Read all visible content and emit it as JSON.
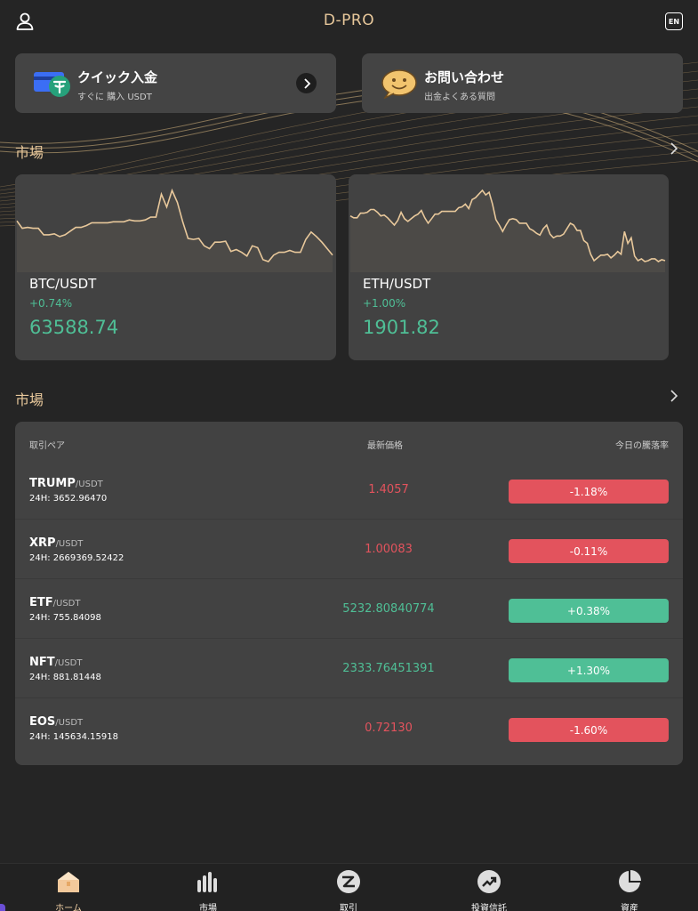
{
  "header": {
    "title": "D-PRO",
    "lang": "EN"
  },
  "quick": [
    {
      "title": "クイック入金",
      "subtitle": "すぐに 購入 USDT"
    },
    {
      "title": "お問い合わせ",
      "subtitle": "出金よくある質問"
    }
  ],
  "sections": {
    "market1": "市場",
    "market2": "市場"
  },
  "cards": [
    {
      "pair": "BTC/USDT",
      "change": "+0.74%",
      "price": "63588.74",
      "spark": [
        255,
        263,
        262,
        263,
        263,
        270,
        270,
        269,
        272,
        270,
        266,
        262,
        262,
        260,
        257,
        257,
        257,
        257,
        256,
        256,
        256,
        254,
        255,
        255,
        254,
        251,
        251,
        226,
        240,
        222,
        235,
        256,
        274,
        275,
        274,
        282,
        285,
        278,
        278,
        277,
        288,
        286,
        289,
        293,
        282,
        284,
        297,
        299,
        292,
        289,
        289,
        287,
        289,
        289,
        275,
        267,
        272,
        278,
        285,
        292
      ]
    },
    {
      "pair": "ETH/USDT",
      "change": "+1.00%",
      "price": "1901.82",
      "spark": [
        248,
        250,
        250,
        245,
        245,
        244,
        241,
        241,
        244,
        248,
        247,
        250,
        254,
        258,
        253,
        244,
        251,
        254,
        251,
        248,
        246,
        242,
        250,
        256,
        251,
        246,
        246,
        243,
        243,
        243,
        243,
        243,
        239,
        238,
        235,
        240,
        230,
        228,
        224,
        220,
        225,
        222,
        235,
        252,
        258,
        265,
        258,
        252,
        251,
        252,
        256,
        256,
        256,
        262,
        264,
        267,
        269,
        262,
        258,
        268,
        272,
        270,
        270,
        268,
        262,
        256,
        258,
        264,
        264,
        275,
        278,
        290,
        297,
        294,
        291,
        291,
        290,
        294,
        291,
        287,
        290,
        265,
        278,
        272,
        292,
        297,
        295,
        298,
        297,
        295,
        295,
        298,
        296,
        297
      ]
    }
  ],
  "table": {
    "headers": [
      "取引ペア",
      "最新価格",
      "今日の騰落率"
    ],
    "rows": [
      {
        "base": "TRUMP",
        "quote": "/USDT",
        "vol": "24H: 3652.96470",
        "last": "1.4057",
        "change": "-1.18%",
        "dir": "down"
      },
      {
        "base": "XRP",
        "quote": "/USDT",
        "vol": "24H: 2669369.52422",
        "last": "1.00083",
        "change": "-0.11%",
        "dir": "down"
      },
      {
        "base": "ETF",
        "quote": "/USDT",
        "vol": "24H: 755.84098",
        "last": "5232.80840774",
        "change": "+0.38%",
        "dir": "up"
      },
      {
        "base": "NFT",
        "quote": "/USDT",
        "vol": "24H: 881.81448",
        "last": "2333.76451391",
        "change": "+1.30%",
        "dir": "up"
      },
      {
        "base": "EOS",
        "quote": "/USDT",
        "vol": "24H: 145634.15918",
        "last": "0.72130",
        "change": "-1.60%",
        "dir": "down"
      }
    ]
  },
  "nav": [
    {
      "label": "ホーム",
      "icon": "home-icon",
      "active": true
    },
    {
      "label": "市場",
      "icon": "bar-chart-icon",
      "active": false
    },
    {
      "label": "取引",
      "icon": "trade-icon",
      "active": false
    },
    {
      "label": "投資信託",
      "icon": "trend-up-icon",
      "active": false
    },
    {
      "label": "資産",
      "icon": "pie-chart-icon",
      "active": false
    }
  ],
  "colors": {
    "accent": "#e8c89b",
    "up": "#4fbf96",
    "down": "#e3535d",
    "card": "#424242",
    "background": "#252525"
  }
}
